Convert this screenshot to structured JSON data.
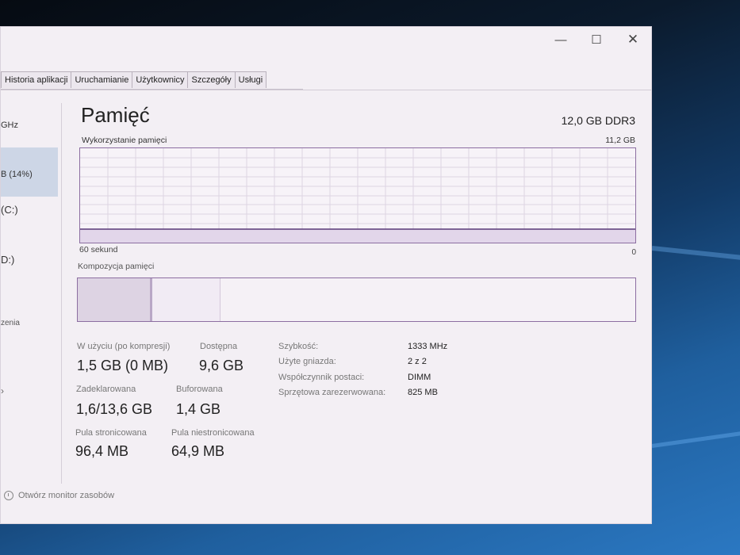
{
  "window": {
    "controls": {
      "minimize": "—",
      "maximize": "☐",
      "close": "✕"
    },
    "tabs": [
      "Historia aplikacji",
      "Uruchamianie",
      "Użytkownicy",
      "Szczegóły",
      "Usługi"
    ]
  },
  "sidebar": {
    "cpu_partial": "GHz",
    "memory_partial": "B (14%)",
    "disk_c_partial": "(C:)",
    "disk_d_partial": "D:)",
    "devices_partial": "zenia",
    "arrow_partial": "›"
  },
  "memory": {
    "title": "Pamięć",
    "type": "12,0 GB DDR3",
    "usage_label": "Wykorzystanie pamięci",
    "usage_max": "11,2 GB",
    "time_label": "60 sekund",
    "time_zero": "0",
    "usage_fraction": 0.14,
    "composition_label": "Kompozycja pamięci",
    "composition": {
      "in_use_fraction": 0.13,
      "modified_fraction": 0.004,
      "standby_fraction": 0.12
    }
  },
  "stats": {
    "in_use_label": "W użyciu (po kompresji)",
    "in_use_value": "1,5 GB (0 MB)",
    "available_label": "Dostępna",
    "available_value": "9,6 GB",
    "committed_label": "Zadeklarowana",
    "committed_value": "1,6/13,6 GB",
    "cached_label": "Buforowana",
    "cached_value": "1,4 GB",
    "paged_pool_label": "Pula stronicowana",
    "paged_pool_value": "96,4 MB",
    "nonpaged_pool_label": "Pula niestronicowana",
    "nonpaged_pool_value": "64,9 MB"
  },
  "specs": [
    {
      "label": "Szybkość:",
      "value": "1333 MHz"
    },
    {
      "label": "Użyte gniazda:",
      "value": "2 z 2"
    },
    {
      "label": "Współczynnik postaci:",
      "value": "DIMM"
    },
    {
      "label": "Sprzętowa zarezerwowana:",
      "value": "825 MB"
    }
  ],
  "footer": {
    "label": "Otwórz monitor zasobów"
  },
  "colors": {
    "accent": "#8c6ea1",
    "graph_line": "#5a3a78",
    "sidebar_selected": "#cdd6e6"
  }
}
